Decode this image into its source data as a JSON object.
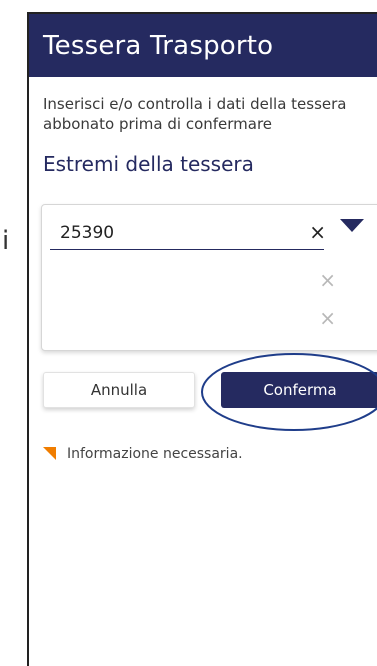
{
  "side_fragment": "i",
  "header": {
    "title": "Tessera Trasporto"
  },
  "intro": {
    "text": "Inserisci e/o controlla i dati della tessera abbonato prima di confermare"
  },
  "section": {
    "title": "Estremi della tessera"
  },
  "fields": [
    {
      "value": "25390",
      "clear_icon": "close-icon",
      "active": true
    },
    {
      "value": "",
      "clear_icon": "close-icon",
      "active": false
    },
    {
      "value": "",
      "clear_icon": "close-icon",
      "active": false
    }
  ],
  "clear_glyph": "×",
  "buttons": {
    "cancel_label": "Annulla",
    "confirm_label": "Conferma"
  },
  "note": {
    "text": "Informazione necessaria.",
    "icon": "required-marker-icon"
  },
  "colors": {
    "primary": "#252a60",
    "accent": "#f07d00",
    "annotation": "#1f3d8a"
  }
}
